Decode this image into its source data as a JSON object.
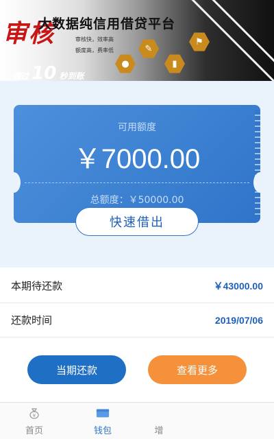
{
  "banner": {
    "title": "大数据纯信用借贷平台",
    "feature_line1": "审核快，效率高",
    "feature_line2": "额度高，费率低",
    "script_text": "审核",
    "slogan_prefix": "通过",
    "slogan_number": "10",
    "slogan_suffix": "秒到账",
    "accent_color": "#c98b1e"
  },
  "card": {
    "available_label": "可用额度",
    "available_amount": "￥7000.00",
    "total_label": "总额度：￥50000.00",
    "borrow_button": "快速借出",
    "card_color": "#2f74c9"
  },
  "rows": [
    {
      "label": "本期待还款",
      "value": "￥43000.00"
    },
    {
      "label": "还款时间",
      "value": "2019/07/06"
    }
  ],
  "actions": {
    "repay_button": "当期还款",
    "more_button": "查看更多",
    "repay_color": "#1f6fc4",
    "more_color": "#f4913a"
  },
  "tabbar": {
    "tabs": [
      {
        "label": "首页",
        "icon": "money-bag-icon"
      },
      {
        "label": "钱包",
        "icon": "wallet-icon"
      },
      {
        "label": "增",
        "icon": "plus-icon"
      }
    ],
    "active_index": 1
  }
}
